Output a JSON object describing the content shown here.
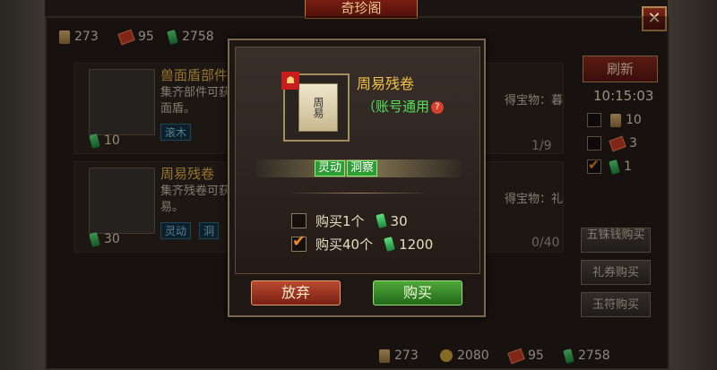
{
  "window": {
    "title": "奇珍阁",
    "close_label": "✕"
  },
  "currencies": [
    {
      "icon": "scroll-icon",
      "value": "273"
    },
    {
      "icon": "ticket-icon",
      "value": "95"
    },
    {
      "icon": "jade-icon",
      "value": "2758"
    }
  ],
  "cards": [
    {
      "name": "兽面盾部件",
      "desc_line1": "集齐部件可获",
      "desc_line2": "面盾。",
      "tags": [
        "滚木"
      ],
      "price": "10",
      "right_text": "得宝物：暮",
      "count": "1/9"
    },
    {
      "name": "周易残卷",
      "desc_line1": "集齐残卷可获",
      "desc_line2": "易。",
      "tags": [
        "灵动",
        "洞"
      ],
      "price": "30",
      "right_text": "得宝物：礼",
      "count": "0/40"
    }
  ],
  "sidebar": {
    "refresh_label": "刷新",
    "timer": "10:15:03",
    "options": [
      {
        "checked": false,
        "icon": "scroll-icon",
        "value": "10"
      },
      {
        "checked": false,
        "icon": "ticket-icon",
        "value": "3"
      },
      {
        "checked": true,
        "icon": "jade-icon",
        "value": "1"
      }
    ],
    "buttons": [
      "五铢钱购买",
      "礼券购买",
      "玉符购买"
    ]
  },
  "bottom_bar": {
    "values": [
      "273",
      "2080",
      "95",
      "2758"
    ]
  },
  "modal": {
    "item_name": "周易残卷",
    "item_image_text": "周易",
    "item_note": "（账号通用",
    "help_label": "?",
    "tags": [
      "灵动",
      "洞察"
    ],
    "options": [
      {
        "checked": false,
        "label": "购买1个",
        "price": "30"
      },
      {
        "checked": true,
        "label": "购买40个",
        "price": "1200"
      }
    ],
    "cancel_label": "放弃",
    "buy_label": "购买"
  }
}
